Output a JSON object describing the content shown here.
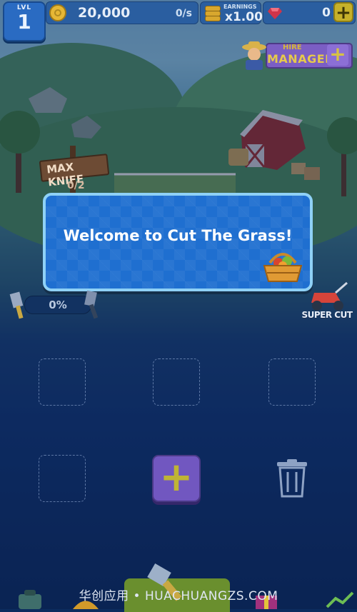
{
  "header": {
    "level_label": "LVL",
    "level_value": "1",
    "money": "20,000",
    "money_rate": "0/s",
    "earnings_label": "EARNINGS",
    "earnings_value": "x1.00",
    "gems": "0",
    "add_gems": "+"
  },
  "manager": {
    "hire_label": "HIRE",
    "manager_label": "MANAGER",
    "plus": "+"
  },
  "world": {
    "sign_title": "MAX KNIFE",
    "sign_progress": "0/2"
  },
  "dialog": {
    "message": "Welcome to Cut The Grass!"
  },
  "status": {
    "progress_text": "0%",
    "super_cut_label": "SUPER CUT"
  },
  "merge_area": {
    "add_button": "+"
  },
  "watermark": "华创应用 • HUACHUANGZS.COM",
  "colors": {
    "dialog_bg": "#1f6fd0",
    "dialog_border": "#8fd1f6",
    "add_button": "#7157c0",
    "manager_box": "#7b5ec4",
    "gold": "#c6b12a"
  }
}
